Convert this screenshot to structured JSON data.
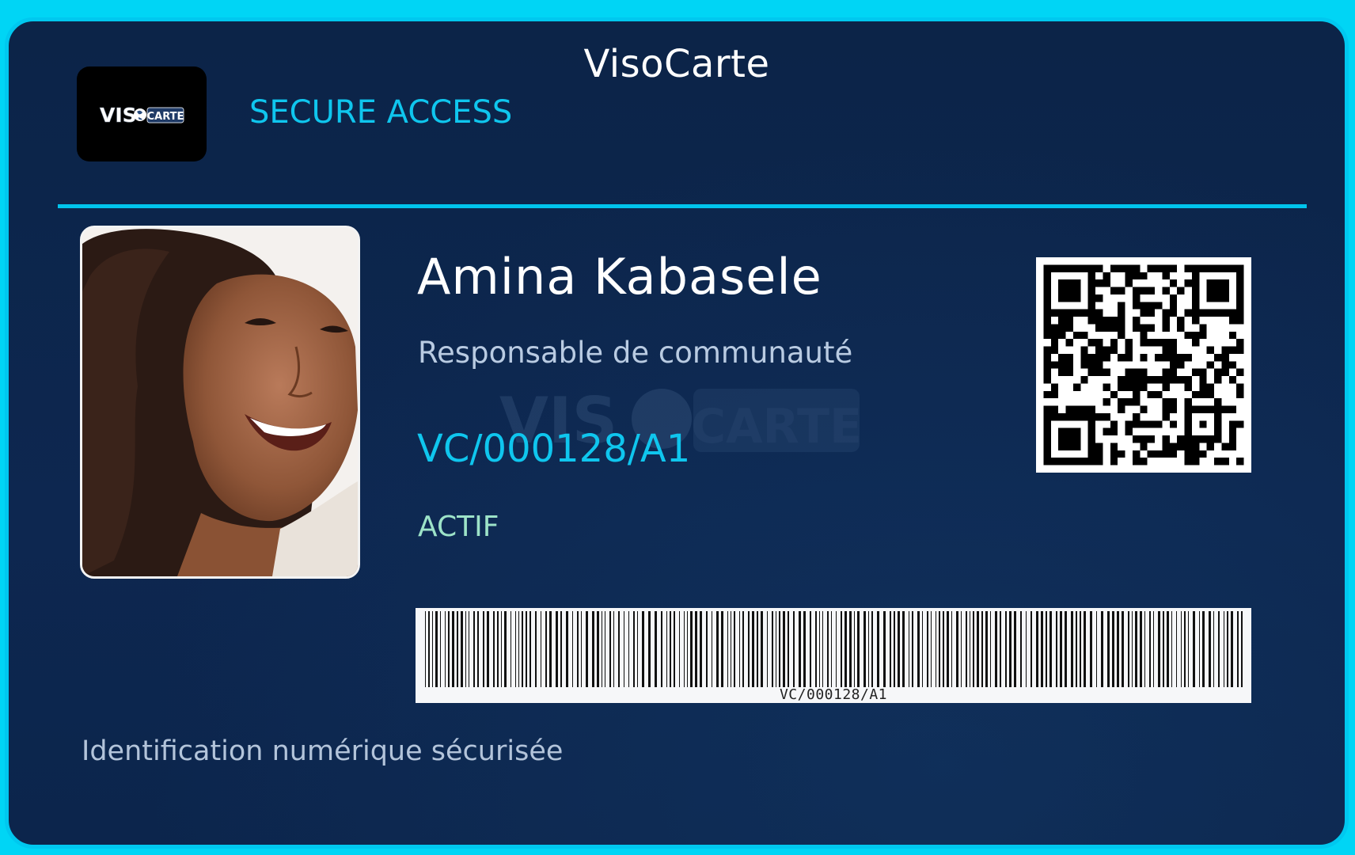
{
  "card": {
    "title": "VisoCarte",
    "subtitle": "SECURE ACCESS",
    "logo": {
      "text_left": "VIS",
      "text_right": "CARTE"
    },
    "holder": {
      "name": "Amina Kabasele",
      "role": "Responsable de communauté",
      "card_id": "VC/000128/A1",
      "status": "ACTIF"
    },
    "barcode_text": "VC/000128/A1",
    "footer": "Identification numérique sécurisée"
  },
  "colors": {
    "accent": "#00c8ef",
    "background": "#0c2448",
    "status": "#9de3c8",
    "muted_text": "#b9cbe2"
  }
}
